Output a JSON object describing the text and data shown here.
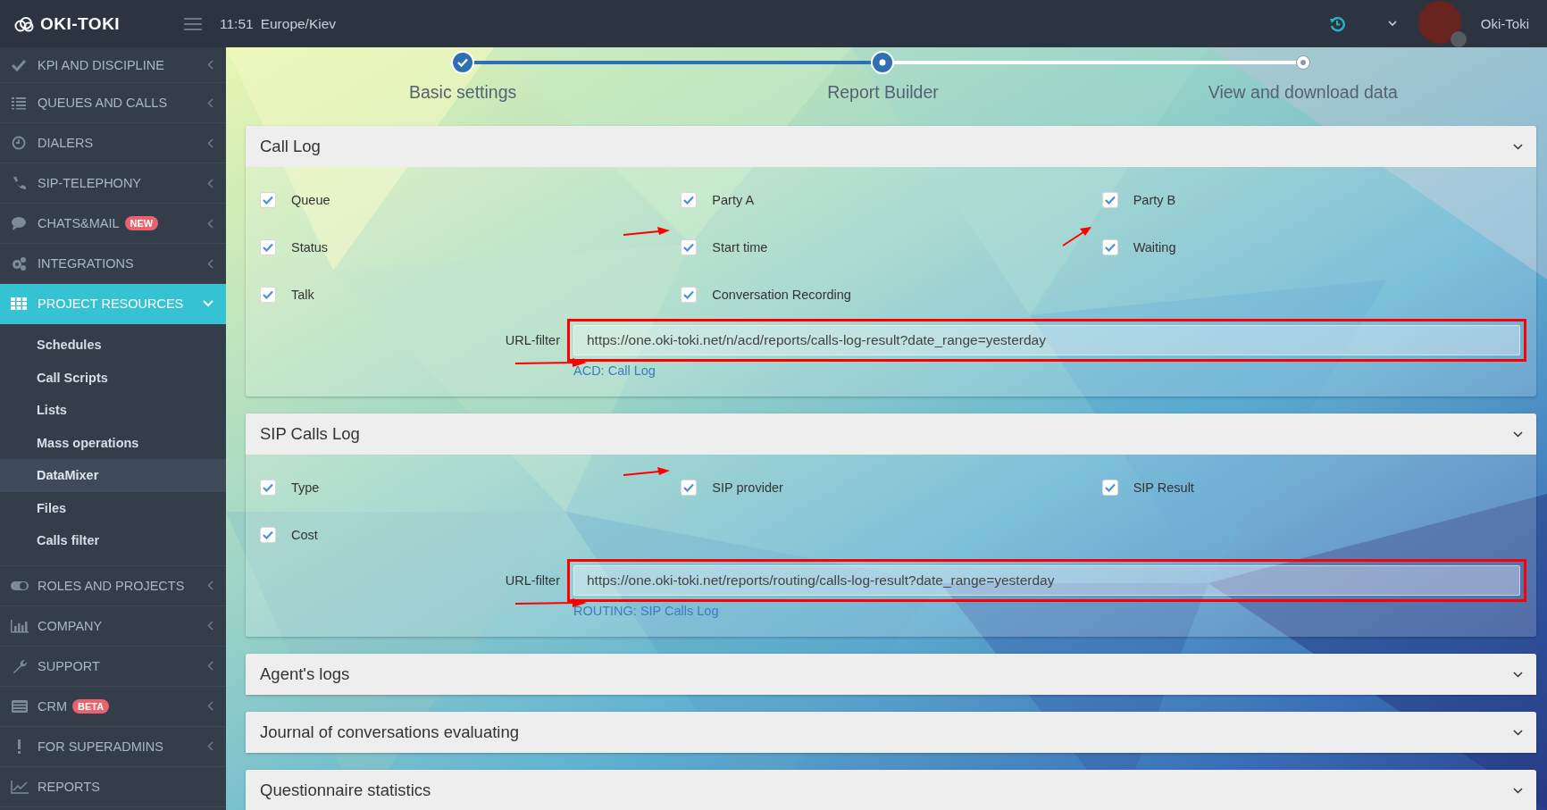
{
  "header": {
    "brand": "OKI-TOKI",
    "time": "11:51",
    "timezone": "Europe/Kiev",
    "user": "Oki-Toki"
  },
  "sidebar": {
    "items": [
      {
        "label": "KPI AND DISCIPLINE",
        "selected": false,
        "expanded": false,
        "kind": "menu"
      },
      {
        "label": "QUEUES AND CALLS",
        "selected": false,
        "expanded": false,
        "kind": "menu"
      },
      {
        "label": "DIALERS",
        "selected": false,
        "expanded": false,
        "kind": "menu"
      },
      {
        "label": "SIP-TELEPHONY",
        "selected": false,
        "expanded": false,
        "kind": "menu"
      },
      {
        "label": "CHATS&MAIL",
        "badge": "NEW",
        "selected": false,
        "expanded": false,
        "kind": "menu"
      },
      {
        "label": "INTEGRATIONS",
        "selected": false,
        "expanded": false,
        "kind": "menu"
      },
      {
        "label": "PROJECT RESOURCES",
        "selected": true,
        "expanded": true,
        "kind": "menu",
        "children": [
          {
            "label": "Schedules",
            "selected": false
          },
          {
            "label": "Call Scripts",
            "selected": false
          },
          {
            "label": "Lists",
            "selected": false
          },
          {
            "label": "Mass operations",
            "selected": false
          },
          {
            "label": "DataMixer",
            "selected": true
          },
          {
            "label": "Files",
            "selected": false
          },
          {
            "label": "Calls filter",
            "selected": false
          }
        ]
      },
      {
        "label": "ROLES AND PROJECTS",
        "selected": false,
        "expanded": false,
        "kind": "menu"
      },
      {
        "label": "COMPANY",
        "selected": false,
        "expanded": false,
        "kind": "menu"
      },
      {
        "label": "SUPPORT",
        "selected": false,
        "expanded": false,
        "kind": "menu"
      },
      {
        "label": "CRM",
        "badge": "BETA",
        "selected": false,
        "expanded": false,
        "kind": "menu"
      },
      {
        "label": "FOR SUPERADMINS",
        "selected": false,
        "expanded": false,
        "kind": "menu"
      },
      {
        "label": "REPORTS",
        "selected": false,
        "expanded": false,
        "kind": "link"
      }
    ]
  },
  "stepper": {
    "steps": [
      {
        "label": "Basic settings",
        "kind": "done"
      },
      {
        "label": "Report Builder",
        "kind": "current"
      },
      {
        "label": "View and download data",
        "kind": "pending"
      }
    ]
  },
  "panels": [
    {
      "title": "Call Log",
      "expanded": true,
      "options": [
        {
          "label": "Queue",
          "checked": true,
          "kind": "plain"
        },
        {
          "label": "Party A",
          "checked": true,
          "kind": "plain"
        },
        {
          "label": "Party B",
          "checked": true,
          "kind": "plain"
        },
        {
          "label": "Status",
          "checked": true,
          "kind": "plain"
        },
        {
          "label": "Start time",
          "checked": true,
          "kind": "arrowed"
        },
        {
          "label": "Waiting",
          "checked": true,
          "kind": "angled"
        },
        {
          "label": "Talk",
          "checked": true,
          "kind": "plain"
        },
        {
          "label": "Conversation Recording",
          "checked": true,
          "kind": "plain"
        }
      ],
      "url_filter": {
        "label": "URL-filter",
        "value": "https://one.oki-toki.net/n/acd/reports/calls-log-result?date_range=yesterday",
        "highlighted": true,
        "arrow": true
      },
      "link": "ACD: Call Log"
    },
    {
      "title": "SIP Calls Log",
      "expanded": true,
      "options": [
        {
          "label": "Type",
          "checked": true,
          "kind": "plain"
        },
        {
          "label": "SIP provider",
          "checked": true,
          "kind": "arrowed"
        },
        {
          "label": "SIP Result",
          "checked": true,
          "kind": "plain"
        },
        {
          "label": "Cost",
          "checked": true,
          "kind": "plain"
        }
      ],
      "url_filter": {
        "label": "URL-filter",
        "value": "https://one.oki-toki.net/reports/routing/calls-log-result?date_range=yesterday",
        "highlighted": true,
        "arrow": true
      },
      "link": "ROUTING: SIP Calls Log"
    },
    {
      "title": "Agent's logs",
      "expanded": false
    },
    {
      "title": "Journal of conversations evaluating",
      "expanded": false
    },
    {
      "title": "Questionnaire statistics",
      "expanded": false
    }
  ]
}
